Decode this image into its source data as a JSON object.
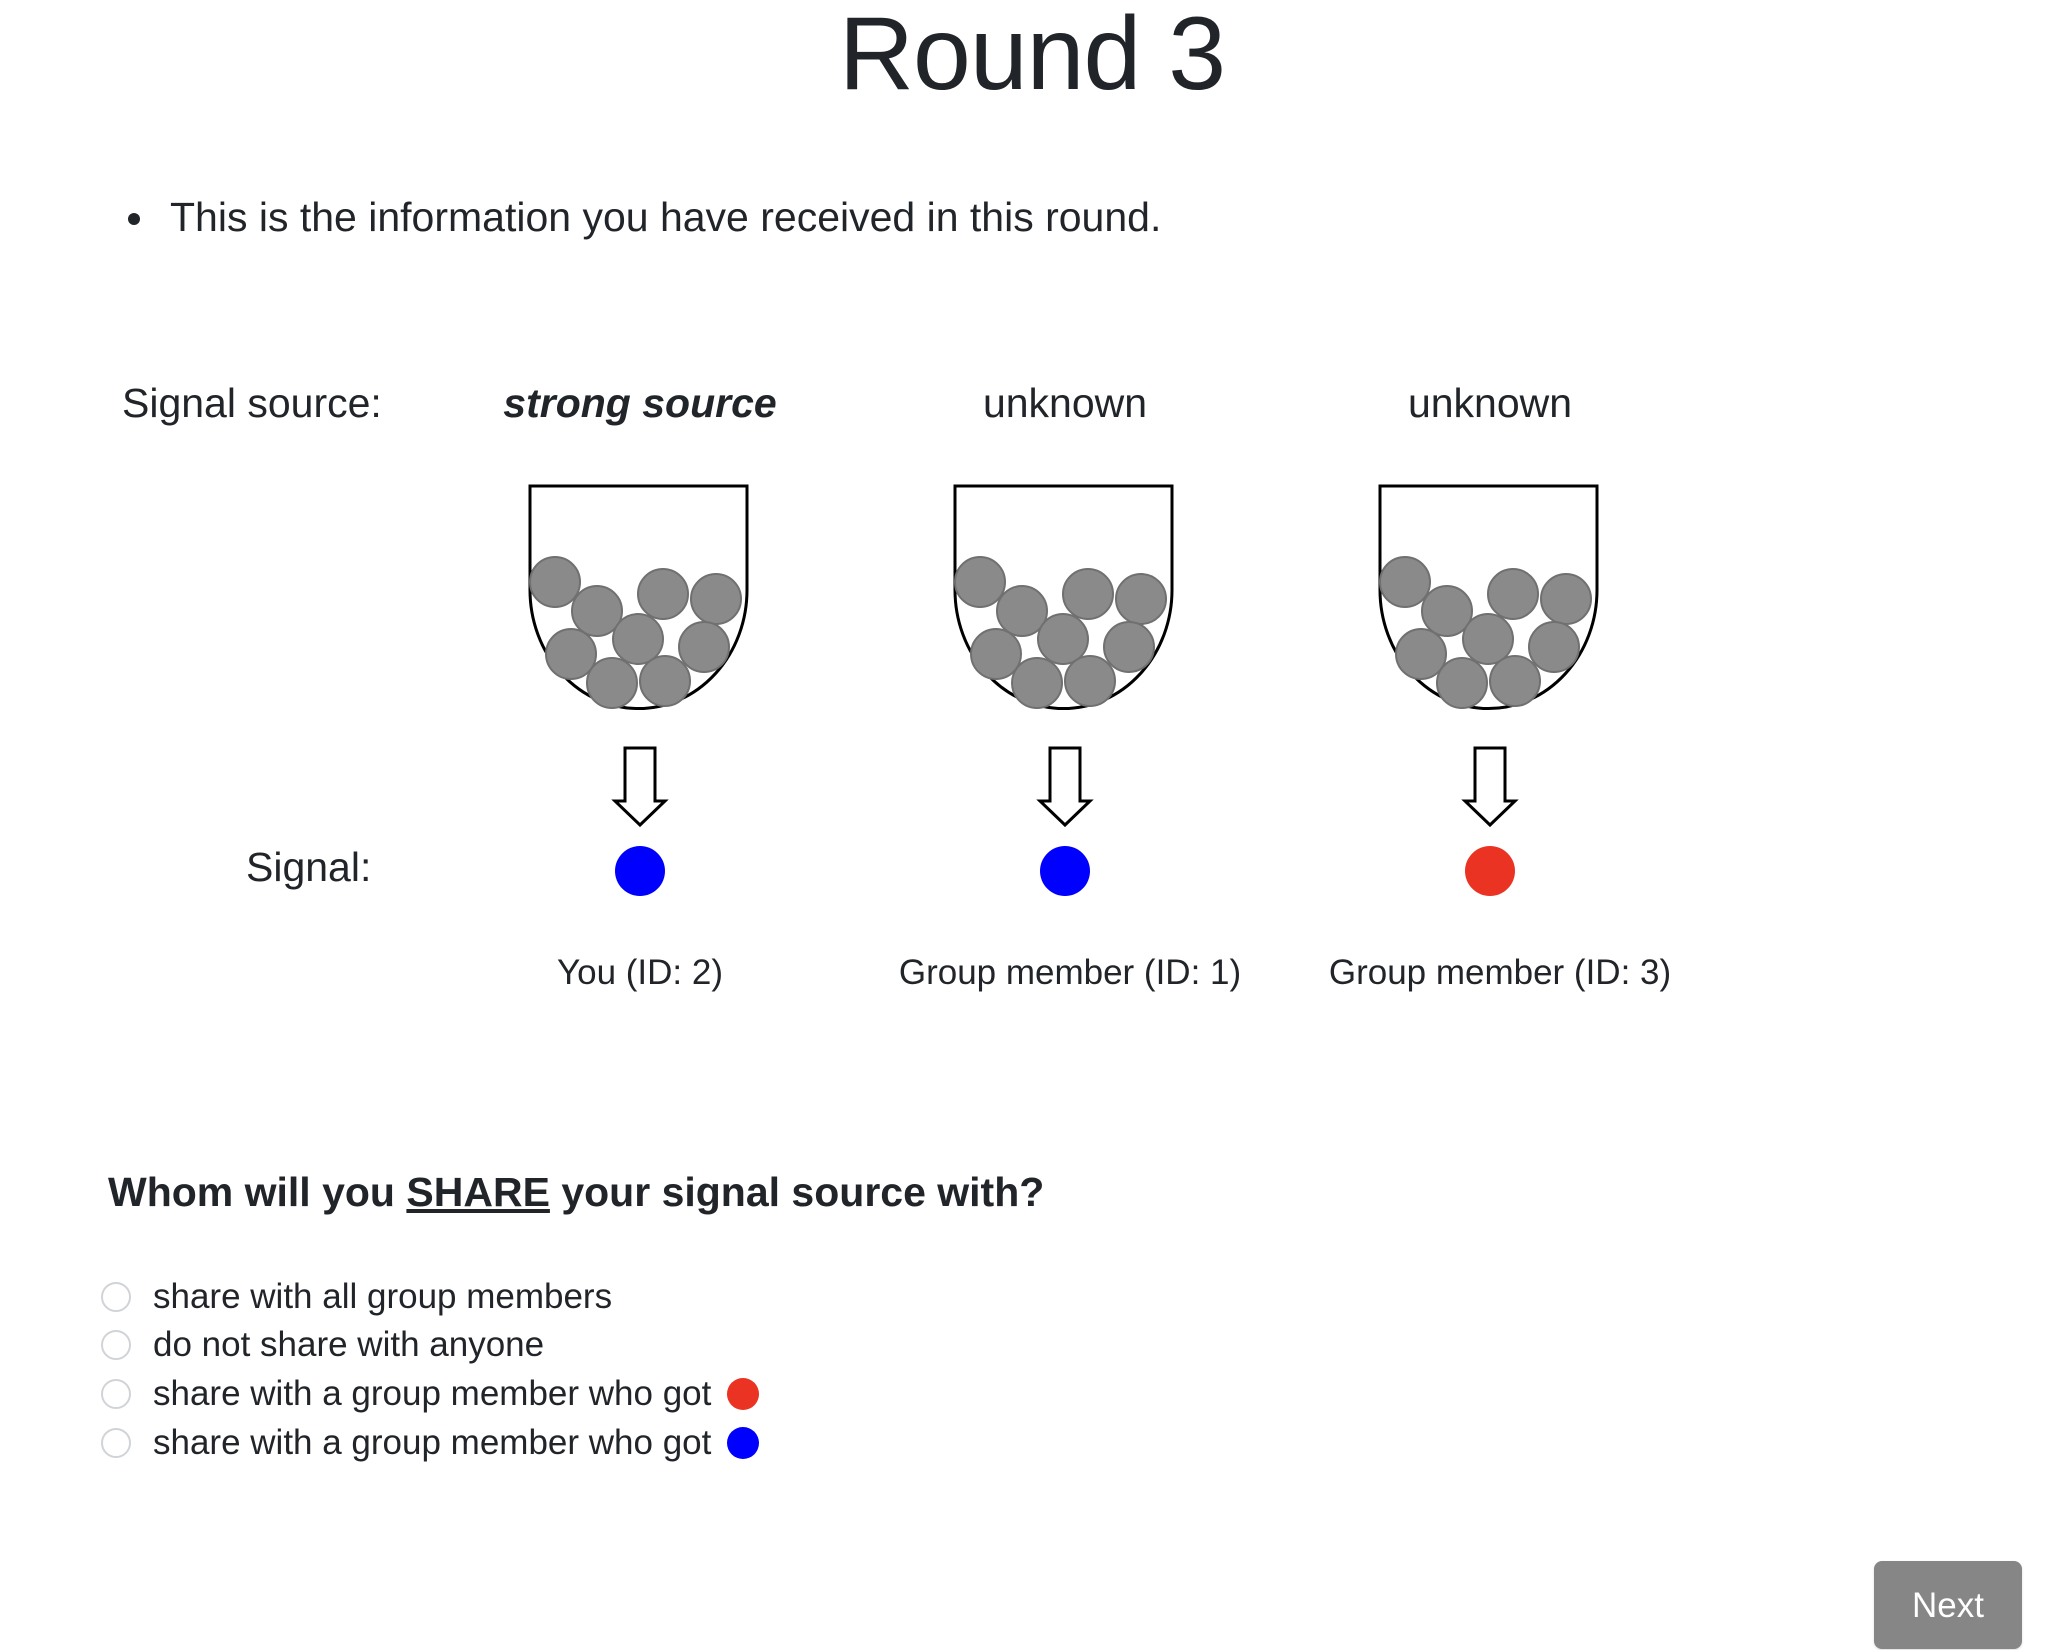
{
  "title": "Round 3",
  "intro": "This is the information you have received in this round.",
  "labels": {
    "signal_source": "Signal source:",
    "signal": "Signal:"
  },
  "columns": [
    {
      "source": "strong source",
      "signal_color": "#0000ff",
      "owner": "You (ID: 2)"
    },
    {
      "source": "unknown",
      "signal_color": "#0000ff",
      "owner": "Group member (ID: 1)"
    },
    {
      "source": "unknown",
      "signal_color": "#ea3323",
      "owner": "Group member (ID: 3)"
    }
  ],
  "colors": {
    "ball_gray": "#8a8a8a",
    "blue": "#0000ff",
    "red": "#ea3323",
    "button_gray": "#868686"
  },
  "question": {
    "prefix": "Whom will you",
    "emphasis": "SHARE",
    "suffix": "your signal source with?"
  },
  "options": [
    {
      "label": "share with all group members",
      "swatch": ""
    },
    {
      "label": "do not share with anyone",
      "swatch": ""
    },
    {
      "label": "share with a group member who got",
      "swatch": "#ea3323"
    },
    {
      "label": "share with a group member who got",
      "swatch": "#0000ff"
    }
  ],
  "next_label": "Next"
}
